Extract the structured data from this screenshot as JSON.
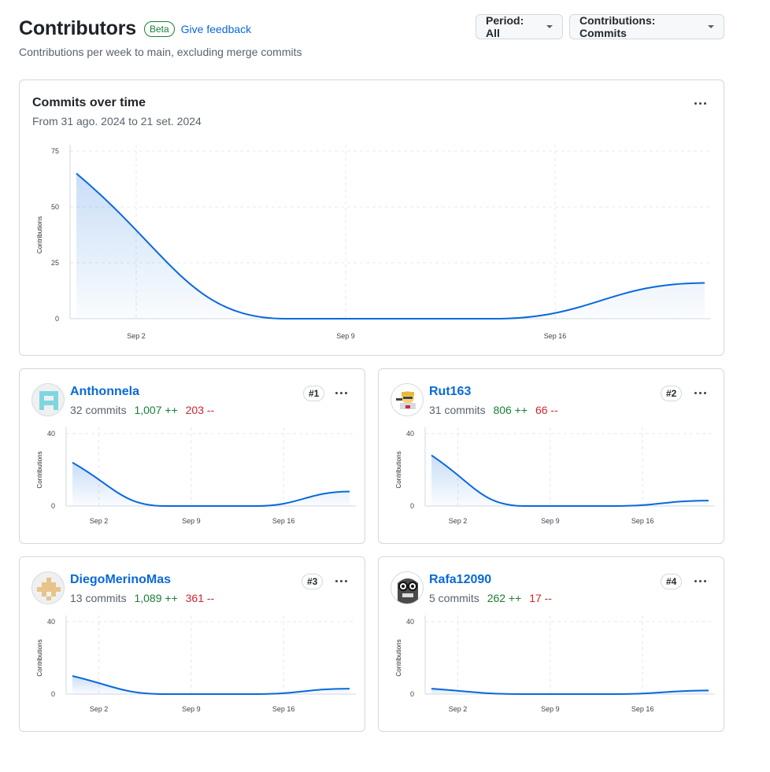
{
  "header": {
    "title": "Contributors",
    "beta": "Beta",
    "feedback": "Give feedback",
    "subtitle": "Contributions per week to main, excluding merge commits",
    "period_label": "Period: All",
    "contributions_label": "Contributions: Commits"
  },
  "overview": {
    "title": "Commits over time",
    "range": "From 31 ago. 2024 to 21 set. 2024"
  },
  "contributors": [
    {
      "name": "Anthonnela",
      "commits": "32 commits",
      "additions": "1,007 ++",
      "deletions": "203 --",
      "rank": "#1"
    },
    {
      "name": "Rut163",
      "commits": "31 commits",
      "additions": "806 ++",
      "deletions": "66 --",
      "rank": "#2"
    },
    {
      "name": "DiegoMerinoMas",
      "commits": "13 commits",
      "additions": "1,089 ++",
      "deletions": "361 --",
      "rank": "#3"
    },
    {
      "name": "Rafa12090",
      "commits": "5 commits",
      "additions": "262 ++",
      "deletions": "17 --",
      "rank": "#4"
    }
  ],
  "colors": {
    "line": "#0969da",
    "add": "#1a7f37",
    "del": "#d1242f",
    "link": "#0969da"
  },
  "chart_data": [
    {
      "type": "area",
      "title": "Commits over time",
      "ylabel": "Contributions",
      "ylim": [
        0,
        75
      ],
      "yticks": [
        "75",
        "50",
        "25",
        "0"
      ],
      "xticks": [
        "Sep 2",
        "Sep 9",
        "Sep 16"
      ],
      "x": [
        "2024-08-31",
        "2024-09-07",
        "2024-09-14",
        "2024-09-21"
      ],
      "values": [
        65,
        0,
        0,
        16
      ]
    },
    {
      "type": "area",
      "series_owner": "Anthonnela",
      "ylabel": "Contributions",
      "ylim": [
        0,
        40
      ],
      "yticks": [
        "40",
        "0"
      ],
      "xticks": [
        "Sep 2",
        "Sep 9",
        "Sep 16"
      ],
      "x": [
        "2024-08-31",
        "2024-09-07",
        "2024-09-14",
        "2024-09-21"
      ],
      "values": [
        24,
        0,
        0,
        8
      ]
    },
    {
      "type": "area",
      "series_owner": "Rut163",
      "ylabel": "Contributions",
      "ylim": [
        0,
        40
      ],
      "yticks": [
        "40",
        "0"
      ],
      "xticks": [
        "Sep 2",
        "Sep 9",
        "Sep 16"
      ],
      "x": [
        "2024-08-31",
        "2024-09-07",
        "2024-09-14",
        "2024-09-21"
      ],
      "values": [
        28,
        0,
        0,
        3
      ]
    },
    {
      "type": "area",
      "series_owner": "DiegoMerinoMas",
      "ylabel": "Contributions",
      "ylim": [
        0,
        40
      ],
      "yticks": [
        "40",
        "0"
      ],
      "xticks": [
        "Sep 2",
        "Sep 9",
        "Sep 16"
      ],
      "x": [
        "2024-08-31",
        "2024-09-07",
        "2024-09-14",
        "2024-09-21"
      ],
      "values": [
        10,
        0,
        0,
        3
      ]
    },
    {
      "type": "area",
      "series_owner": "Rafa12090",
      "ylabel": "Contributions",
      "ylim": [
        0,
        40
      ],
      "yticks": [
        "40",
        "0"
      ],
      "xticks": [
        "Sep 2",
        "Sep 9",
        "Sep 16"
      ],
      "x": [
        "2024-08-31",
        "2024-09-07",
        "2024-09-14",
        "2024-09-21"
      ],
      "values": [
        3,
        0,
        0,
        2
      ]
    }
  ]
}
